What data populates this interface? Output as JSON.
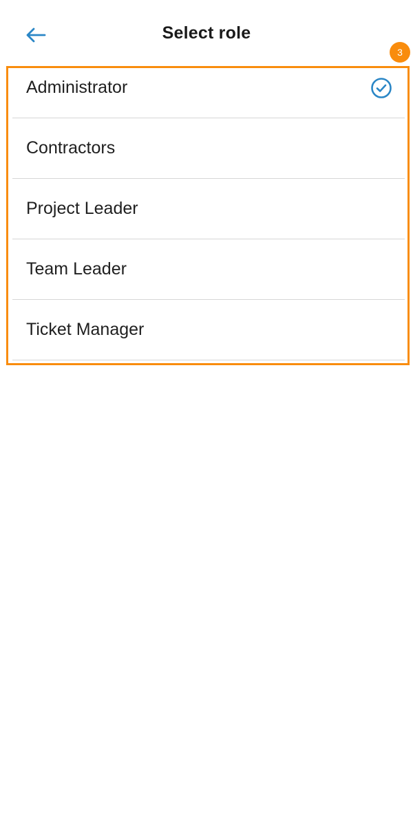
{
  "header": {
    "back_icon": "arrow-left-icon",
    "title": "Select role"
  },
  "annotation": {
    "badge_number": "3",
    "highlight_color": "#f98c0d"
  },
  "roles": [
    {
      "label": "Administrator",
      "selected": true
    },
    {
      "label": "Contractors",
      "selected": false
    },
    {
      "label": "Project Leader",
      "selected": false
    },
    {
      "label": "Team Leader",
      "selected": false
    },
    {
      "label": "Ticket Manager",
      "selected": false
    }
  ],
  "selected_icon": "check-circle-icon",
  "colors": {
    "accent": "#2a86c6",
    "divider": "#d6d6d6",
    "text": "#1f1f1f"
  }
}
